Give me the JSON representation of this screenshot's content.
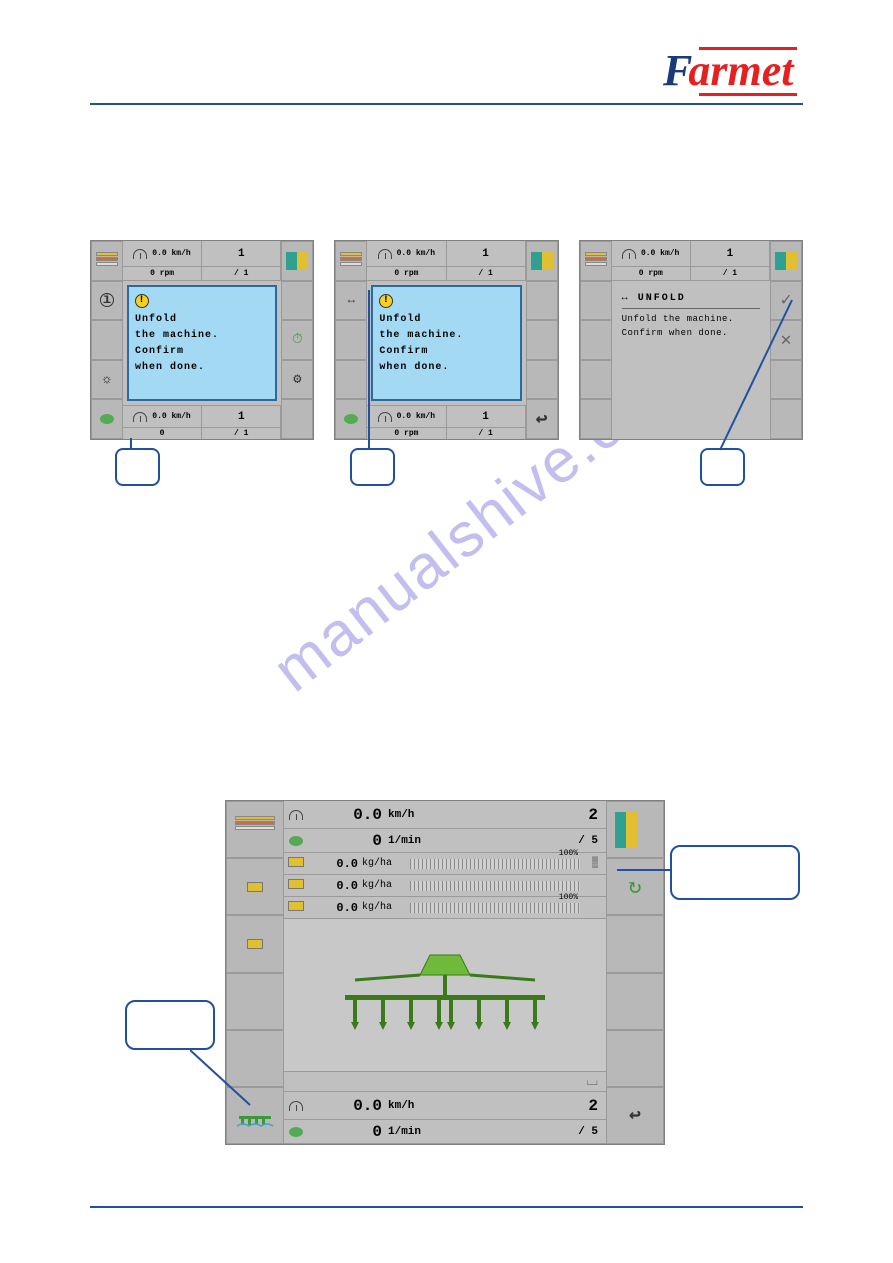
{
  "brand": {
    "f": "F",
    "armet": "armet"
  },
  "watermark": "manualshive.com",
  "mini": {
    "top_speed": "0.0",
    "top_speed_unit": "km/h",
    "top_rpm": "0",
    "top_rpm_unit": "rpm",
    "top_count": "1",
    "top_frac": "/ 1",
    "bot_speed": "0.0",
    "bot_speed_unit": "km/h",
    "bot_rpm": "0",
    "bot_rpm_unit": "rpm",
    "bot_count": "1",
    "bot_frac": "/ 1",
    "warn_mark": "!",
    "msg_l1": "Unfold",
    "msg_l2": "the machine.",
    "msg_l3": "Confirm",
    "msg_l4": "when done.",
    "unfold_title": "UNFOLD",
    "unfold_line1": "Unfold the machine.",
    "unfold_line2": "Confirm when done.",
    "info_glyph": "i",
    "bulb_glyph": "☼",
    "gear_glyph": "⚙",
    "clock_glyph": "⏱",
    "back_glyph": "↩",
    "check_glyph": "✓",
    "x_glyph": "✕",
    "unfold_icon": "↔"
  },
  "large": {
    "speed": "0.0",
    "speed_unit": "km/h",
    "rpm": "0",
    "rpm_unit": "1/min",
    "count": "2",
    "frac": "/ 5",
    "kg1": "0.0",
    "kg2": "0.0",
    "kg3": "0.0",
    "kg_unit": "kg/ha",
    "pct": "100%",
    "bot_speed": "0.0",
    "bot_speed_unit": "km/h",
    "bot_rpm": "0",
    "bot_rpm_unit": "1/min",
    "bot_count": "2",
    "bot_frac": "/ 5",
    "refresh": "↻",
    "back": "↩",
    "bracket": "⌴"
  }
}
